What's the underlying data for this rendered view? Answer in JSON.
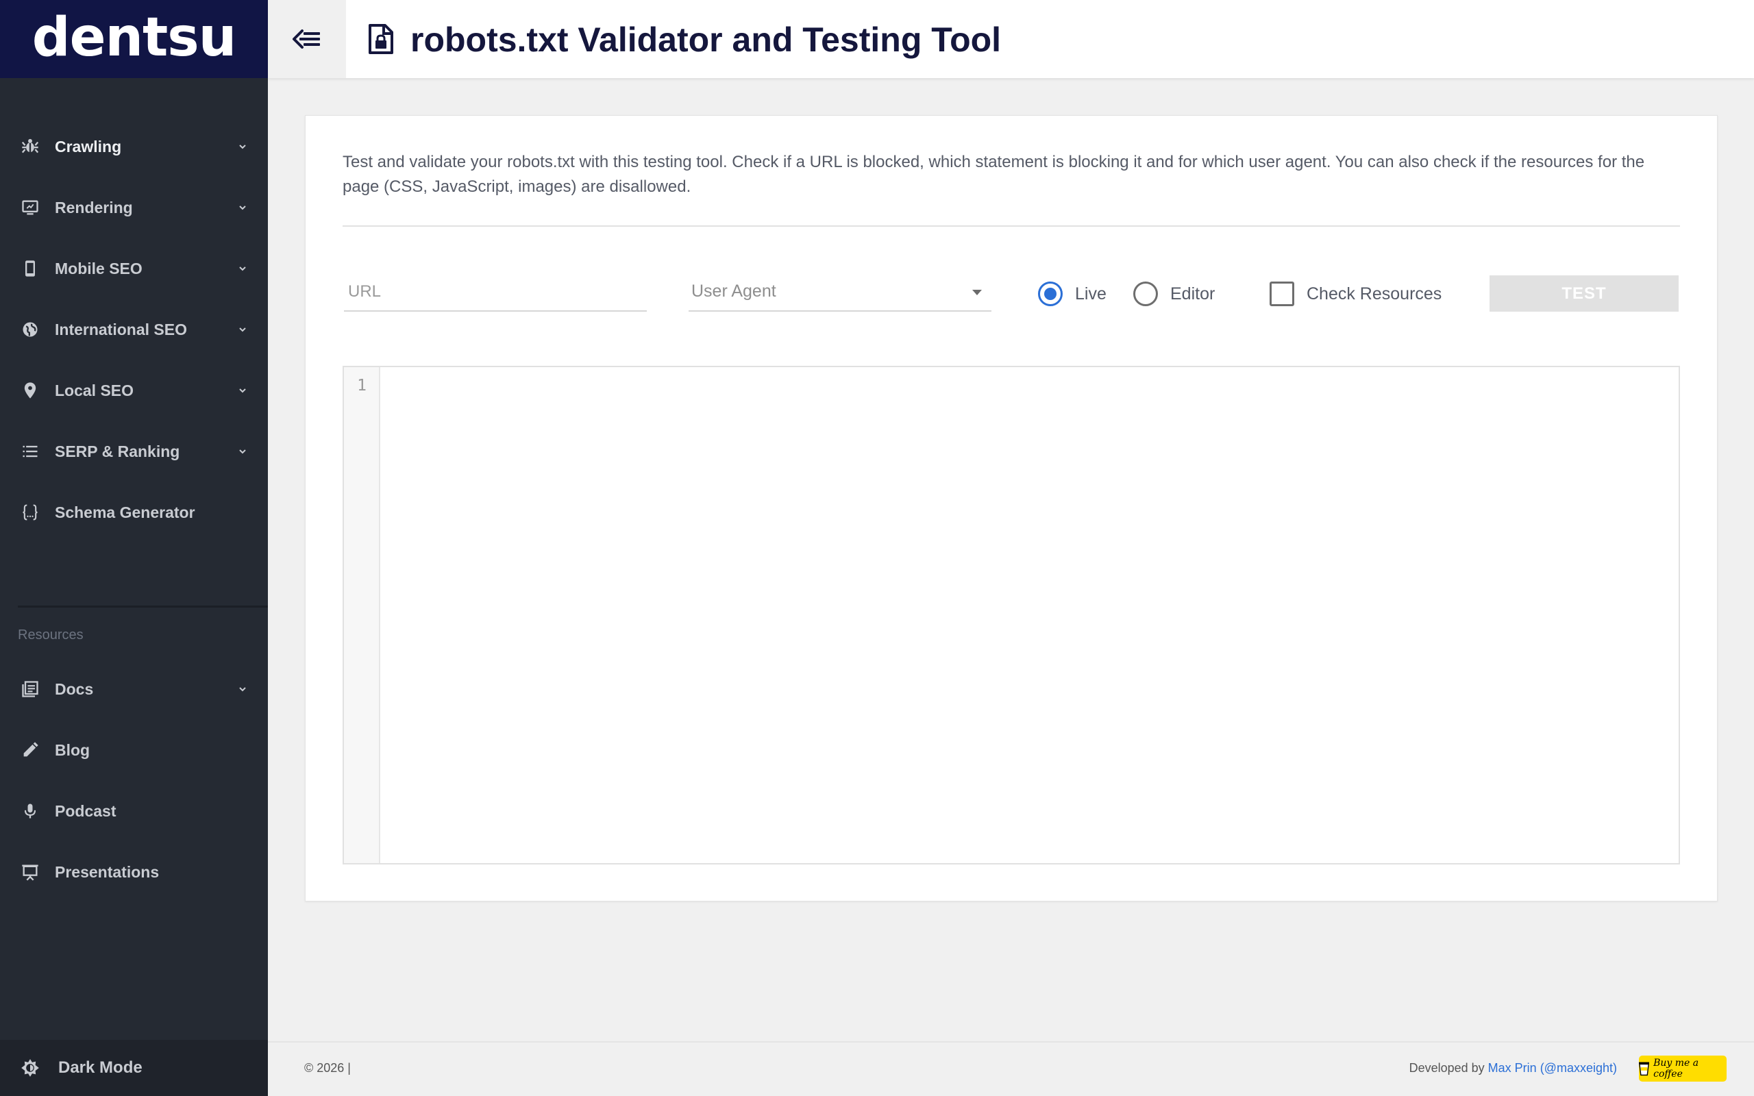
{
  "brand": {
    "logo_text": "dentsu",
    "logo_bg": "#111545"
  },
  "header": {
    "title": "robots.txt Validator and Testing Tool"
  },
  "sidebar": {
    "items": [
      {
        "label": "Crawling",
        "icon": "bug-icon",
        "has_submenu": true
      },
      {
        "label": "Rendering",
        "icon": "monitor-icon",
        "has_submenu": true
      },
      {
        "label": "Mobile SEO",
        "icon": "phone-icon",
        "has_submenu": true
      },
      {
        "label": "International SEO",
        "icon": "globe-icon",
        "has_submenu": true
      },
      {
        "label": "Local SEO",
        "icon": "map-pin-icon",
        "has_submenu": true
      },
      {
        "label": "SERP & Ranking",
        "icon": "list-icon",
        "has_submenu": true
      },
      {
        "label": "Schema Generator",
        "icon": "braces-icon",
        "has_submenu": false
      }
    ],
    "section_title": "Resources",
    "resources": [
      {
        "label": "Docs",
        "icon": "docs-icon",
        "has_submenu": true
      },
      {
        "label": "Blog",
        "icon": "pencil-icon",
        "has_submenu": false
      },
      {
        "label": "Podcast",
        "icon": "microphone-icon",
        "has_submenu": false
      },
      {
        "label": "Presentations",
        "icon": "presentation-icon",
        "has_submenu": false
      }
    ],
    "dark_mode_label": "Dark Mode"
  },
  "main": {
    "intro": "Test and validate your robots.txt with this testing tool. Check if a URL is blocked, which statement is blocking it and for which user agent. You can also check if the resources for the page (CSS, JavaScript, images) are disallowed.",
    "url_placeholder": "URL",
    "user_agent_placeholder": "User Agent",
    "mode_live_label": "Live",
    "mode_editor_label": "Editor",
    "selected_mode": "Live",
    "check_resources_label": "Check Resources",
    "check_resources_checked": false,
    "test_button_label": "TEST",
    "editor_line_number": "1",
    "accent_color": "#2b6fd6"
  },
  "footer": {
    "copyright": "© 2026 |",
    "developed_by": "Developed by",
    "developer_link": "Max Prin (@maxxeight)",
    "coffee_label": "Buy me a coffee"
  }
}
